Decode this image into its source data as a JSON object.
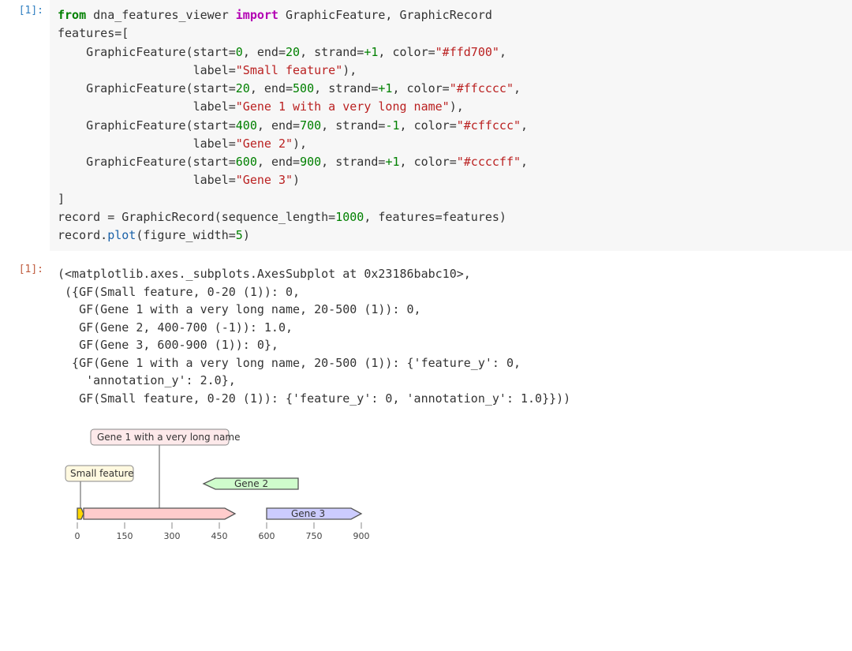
{
  "prompts": {
    "in1": "[1]:",
    "out1": "[1]:"
  },
  "code": {
    "from": "from",
    "module": "dna_features_viewer",
    "import": "import",
    "imports": "GraphicFeature, GraphicRecord",
    "l2": "features=[",
    "gf": "GraphicFeature",
    "start": "start=",
    "end": "end=",
    "strand": "strand=",
    "color": "color=",
    "label": "label=",
    "f1_start": "0",
    "f1_end": "20",
    "f1_strand": "+1",
    "f1_color": "\"#ffd700\"",
    "f1_label": "\"Small feature\"",
    "f2_start": "20",
    "f2_end": "500",
    "f2_strand": "+1",
    "f2_color": "\"#ffcccc\"",
    "f2_label": "\"Gene 1 with a very long name\"",
    "f3_start": "400",
    "f3_end": "700",
    "f3_strand": "-1",
    "f3_color": "\"#cffccc\"",
    "f3_label": "\"Gene 2\"",
    "f4_start": "600",
    "f4_end": "900",
    "f4_strand": "+1",
    "f4_color": "\"#ccccff\"",
    "f4_label": "\"Gene 3\"",
    "close": "]",
    "rec1a": "record = GraphicRecord(sequence_length=",
    "rec1b": ", features=features)",
    "seq_len": "1000",
    "rec2a": "record.",
    "rec2b": "plot",
    "rec2c": "(figure_width=",
    "fw": "5",
    "rec2d": ")",
    "comma": ","
  },
  "output": {
    "text": "(<matplotlib.axes._subplots.AxesSubplot at 0x23186babc10>,\n ({GF(Small feature, 0-20 (1)): 0,\n   GF(Gene 1 with a very long name, 20-500 (1)): 0,\n   GF(Gene 2, 400-700 (-1)): 1.0,\n   GF(Gene 3, 600-900 (1)): 0},\n  {GF(Gene 1 with a very long name, 20-500 (1)): {'feature_y': 0,\n    'annotation_y': 2.0},\n   GF(Small feature, 0-20 (1)): {'feature_y': 0, 'annotation_y': 1.0}}))"
  },
  "chart_data": {
    "type": "table",
    "title": "DNA features plot (GraphicRecord)",
    "sequence_length": 1000,
    "xticks": [
      0,
      150,
      300,
      450,
      600,
      750,
      900
    ],
    "features": [
      {
        "label": "Small feature",
        "start": 0,
        "end": 20,
        "strand": 1,
        "color": "#ffd700",
        "level": 0,
        "annotation_y": 1
      },
      {
        "label": "Gene 1 with a very long name",
        "start": 20,
        "end": 500,
        "strand": 1,
        "color": "#ffcccc",
        "level": 0,
        "annotation_y": 2
      },
      {
        "label": "Gene 2",
        "start": 400,
        "end": 700,
        "strand": -1,
        "color": "#cffccc",
        "level": 1
      },
      {
        "label": "Gene 3",
        "start": 600,
        "end": 900,
        "strand": 1,
        "color": "#ccccff",
        "level": 0
      }
    ],
    "labels": {
      "small": "Small feature",
      "gene1": "Gene 1 with a very long name",
      "gene2": "Gene 2",
      "gene3": "Gene 3"
    },
    "ticks": {
      "t0": "0",
      "t150": "150",
      "t300": "300",
      "t450": "450",
      "t600": "600",
      "t750": "750",
      "t900": "900"
    }
  }
}
